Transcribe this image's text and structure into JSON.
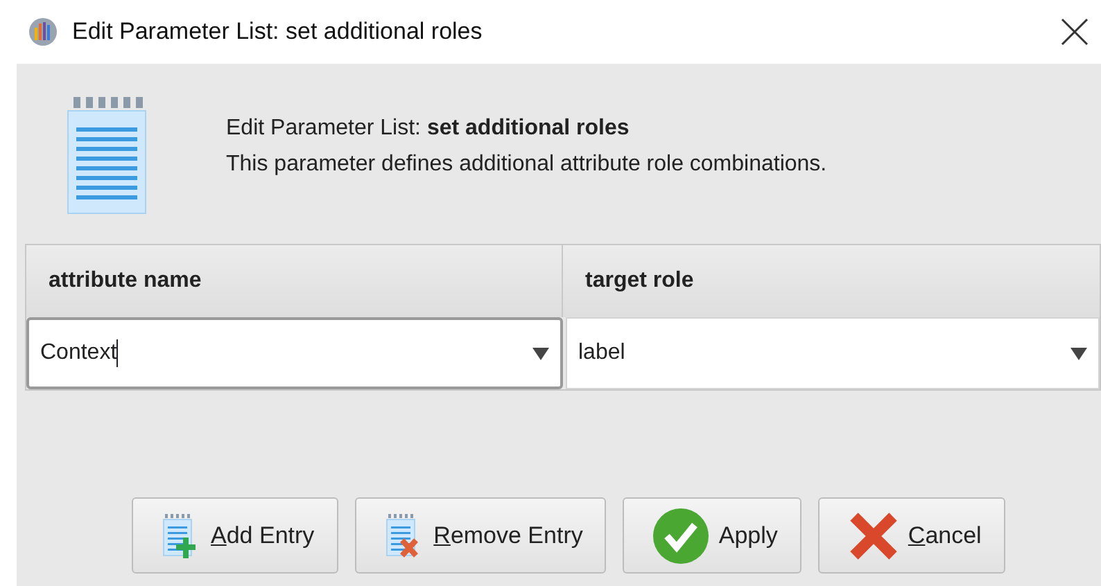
{
  "window": {
    "title": "Edit Parameter List: set additional roles"
  },
  "header": {
    "title": "Edit Parameter List: **set additional roles**",
    "description": "This parameter defines additional attribute role combinations."
  },
  "table": {
    "columns": [
      "attribute name",
      "target role"
    ],
    "rows": [
      {
        "cells": [
          {
            "value": "Context",
            "focused": true
          },
          {
            "value": "label",
            "focused": false
          }
        ]
      }
    ]
  },
  "buttons": [
    {
      "kind": "add",
      "label": "Add Entry",
      "underline_first": true
    },
    {
      "kind": "remove",
      "label": "Remove Entry",
      "underline_first": true
    },
    {
      "kind": "apply",
      "label": "Apply",
      "underline_first": false
    },
    {
      "kind": "cancel",
      "label": "Cancel",
      "underline_first": true
    }
  ]
}
